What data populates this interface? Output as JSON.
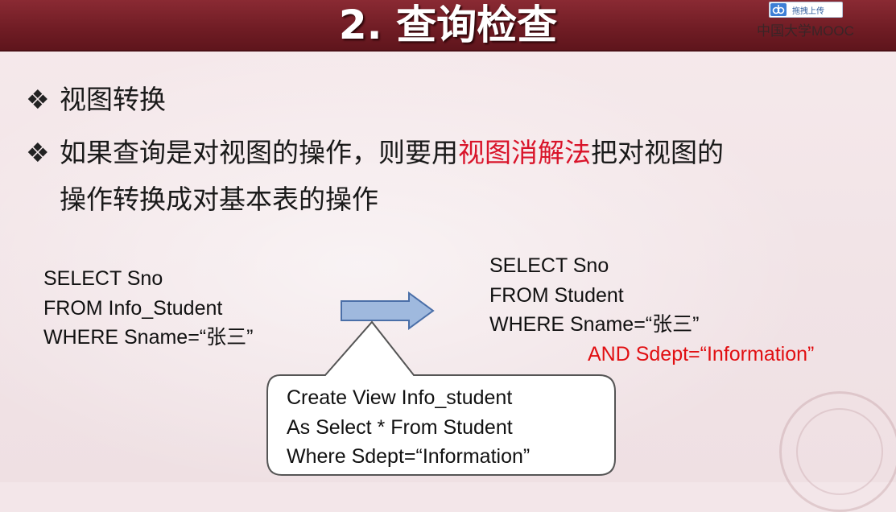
{
  "header": {
    "title": "2. 查询检查",
    "upload_button_label": "拖拽上传",
    "watermark": "中国大学MOOC",
    "upload_icon": "cloud-upload-icon"
  },
  "bullets": {
    "marker": "❖",
    "item1": "视图转换",
    "item2_before": "如果查询是对视图的操作，则要用",
    "item2_highlight": "视图消解法",
    "item2_after": "把对视图的",
    "item2_line2": "操作转换成对基本表的操作"
  },
  "left_query": {
    "line1": "SELECT Sno",
    "line2": "FROM Info_Student",
    "line3": "WHERE Sname=“张三”"
  },
  "right_query": {
    "line1": "SELECT Sno",
    "line2": "FROM Student",
    "line3": "WHERE Sname=“张三”",
    "line4": "AND  Sdept=“Information”"
  },
  "view_definition": {
    "line1": "Create View Info_student",
    "line2": "As  Select * From Student",
    "line3": "Where Sdept=“Information”"
  },
  "colors": {
    "header": "#7a222b",
    "highlight": "#d9142a",
    "added_condition": "#e10f12",
    "arrow_fill": "#9fb9de"
  }
}
